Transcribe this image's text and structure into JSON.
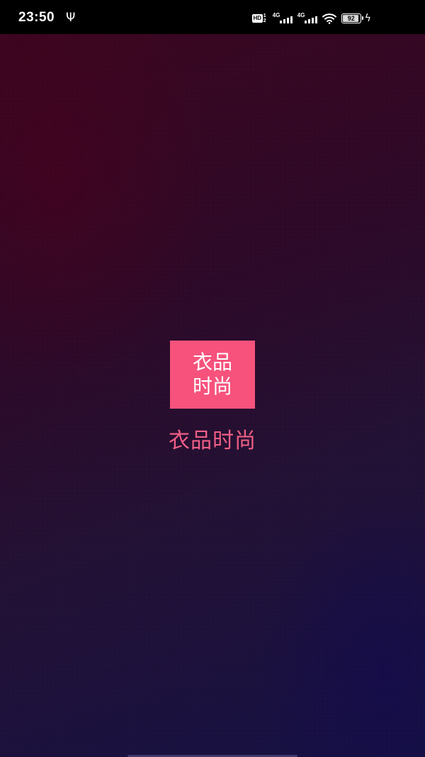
{
  "status_bar": {
    "time": "23:50",
    "hd_label": "HD",
    "hd_sub_top": "1",
    "hd_sub_bottom": "2",
    "network_1": "4G",
    "network_2": "4G",
    "battery_level": "92",
    "icons": [
      "usb-icon",
      "hd-icon",
      "signal-4g-icon",
      "signal-4g-icon",
      "wifi-icon",
      "battery-icon",
      "charging-icon"
    ]
  },
  "splash": {
    "logo_line_1": "衣品",
    "logo_line_2": "时尚",
    "app_name": "衣品时尚",
    "colors": {
      "logo_background": "#f6527c",
      "logo_text": "#ffffff",
      "app_name_text": "#f25f86",
      "background_top": "#3d0620",
      "background_bottom": "#161246"
    }
  }
}
